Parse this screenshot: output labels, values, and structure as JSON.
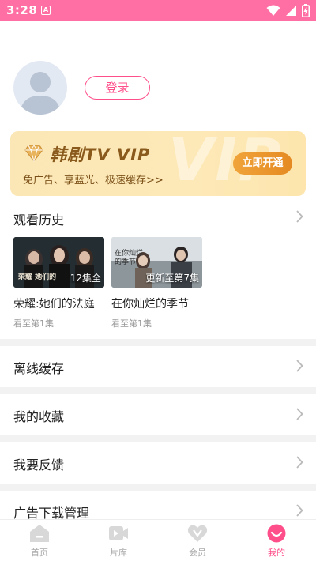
{
  "status_bar": {
    "time": "3:28",
    "notification_glyph": "A"
  },
  "profile": {
    "login_label": "登录"
  },
  "vip": {
    "title": "韩剧TV VIP",
    "subtitle": "免广告、享蓝光、极速缓存>>",
    "button": "立即开通",
    "watermark": "VIP"
  },
  "history": {
    "title": "观看历史",
    "items": [
      {
        "title": "荣耀:她们的法庭",
        "badge": "12集全",
        "progress": "看至第1集",
        "thumb_text": "荣耀 她们的"
      },
      {
        "title": "在你灿烂的季节",
        "badge": "更新至第7集",
        "progress": "看至第1集",
        "thumb_text": "在你灿烂 的季节"
      }
    ]
  },
  "menu": {
    "offline": "离线缓存",
    "favorites": "我的收藏",
    "feedback": "我要反馈",
    "ad_download": "广告下载管理"
  },
  "nav": {
    "home": "首页",
    "library": "片库",
    "member": "会员",
    "mine": "我的"
  },
  "colors": {
    "accent": "#ff4f8b",
    "status_bar": "#ff6fa3",
    "vip_gold": "#e58a22"
  }
}
